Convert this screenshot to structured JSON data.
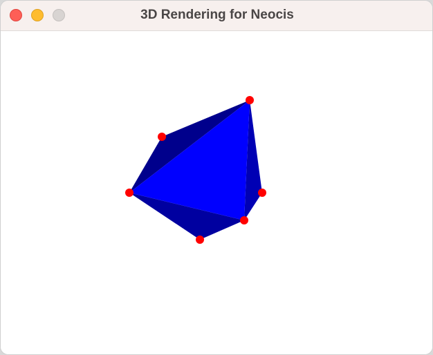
{
  "window": {
    "title": "3D Rendering for Neocis"
  },
  "colors": {
    "face_front": "#0000ff",
    "face_shade_1": "#00008c",
    "face_shade_2": "#0000b4",
    "face_shade_3": "#0000a0",
    "vertex": "#ff0000"
  },
  "icons": {
    "close": "close-traffic-light-icon",
    "minimize": "minimize-traffic-light-icon",
    "zoom": "zoom-traffic-light-icon"
  }
}
